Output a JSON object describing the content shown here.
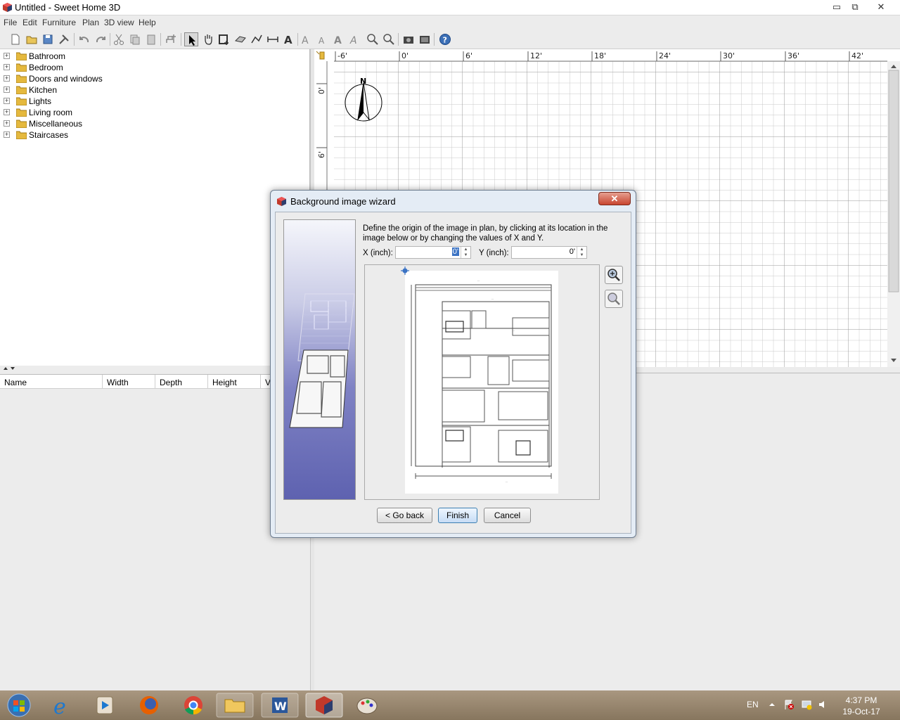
{
  "window": {
    "title": "Untitled - Sweet Home 3D",
    "min": "▭",
    "max": "⧉",
    "close": "✕"
  },
  "menu": [
    "File",
    "Edit",
    "Furniture",
    "Plan",
    "3D view",
    "Help"
  ],
  "catalog": {
    "categories": [
      "Bathroom",
      "Bedroom",
      "Doors and windows",
      "Kitchen",
      "Lights",
      "Living room",
      "Miscellaneous",
      "Staircases"
    ],
    "expander": "+"
  },
  "furniture_table": {
    "columns": [
      "Name",
      "Width",
      "Depth",
      "Height",
      "Vi"
    ]
  },
  "plan": {
    "ruler_x": [
      "-6'",
      "0'",
      "6'",
      "12'",
      "18'",
      "24'",
      "30'",
      "36'",
      "42'"
    ],
    "ruler_y": [
      "0'",
      "6'"
    ],
    "compass_label": "N"
  },
  "dialog": {
    "title": "Background image wizard",
    "close": "✕",
    "instructions": "Define the origin of the image in plan, by clicking at its location in the image below or by changing the values of X and Y.",
    "x_label": "X (inch):",
    "x_value": "0'",
    "y_label": "Y (inch):",
    "y_value": "0'",
    "back_label": "< Go back",
    "finish_label": "Finish",
    "cancel_label": "Cancel"
  },
  "taskbar": {
    "language": "EN",
    "time": "4:37 PM",
    "date": "19-Oct-17"
  }
}
